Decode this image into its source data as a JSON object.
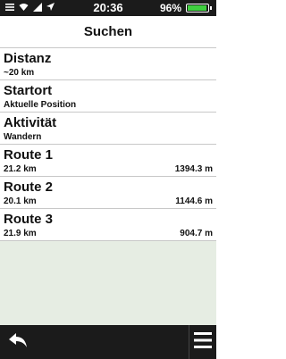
{
  "status_bar": {
    "time": "20:36",
    "battery_percent": "96%",
    "battery_level": 0.96,
    "battery_color": "#3fcf3f",
    "icons": [
      "menu-icon",
      "wifi-icon",
      "signal-icon",
      "location-icon"
    ]
  },
  "header": {
    "title": "Suchen"
  },
  "rows": [
    {
      "title": "Distanz",
      "subtitle": "~20 km",
      "right": ""
    },
    {
      "title": "Startort",
      "subtitle": "Aktuelle Position",
      "right": ""
    },
    {
      "title": "Aktivität",
      "subtitle": "Wandern",
      "right": ""
    },
    {
      "title": "Route 1",
      "subtitle": "21.2 km",
      "right": "1394.3 m"
    },
    {
      "title": "Route 2",
      "subtitle": "20.1 km",
      "right": "1144.6 m"
    },
    {
      "title": "Route 3",
      "subtitle": "21.9 km",
      "right": "904.7 m"
    }
  ],
  "bottom_bar": {
    "back_icon": "back-arrow-icon",
    "menu_icon": "hamburger-menu-icon"
  }
}
